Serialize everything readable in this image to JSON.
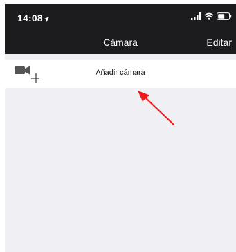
{
  "status_bar": {
    "time": "14:08",
    "icons": [
      "location-arrow-icon",
      "signal-bars-icon",
      "wifi-icon",
      "battery-icon"
    ]
  },
  "nav": {
    "title": "Cámara",
    "edit_label": "Editar"
  },
  "camera_list": {
    "add_row": {
      "label": "Añadir cámara",
      "icon": "add-camera-icon"
    }
  },
  "annotation": {
    "icon": "red-arrow-icon",
    "color": "#ee1c1c"
  },
  "colors": {
    "bar_background": "#1c1c1e",
    "list_background": "#efeff4"
  }
}
